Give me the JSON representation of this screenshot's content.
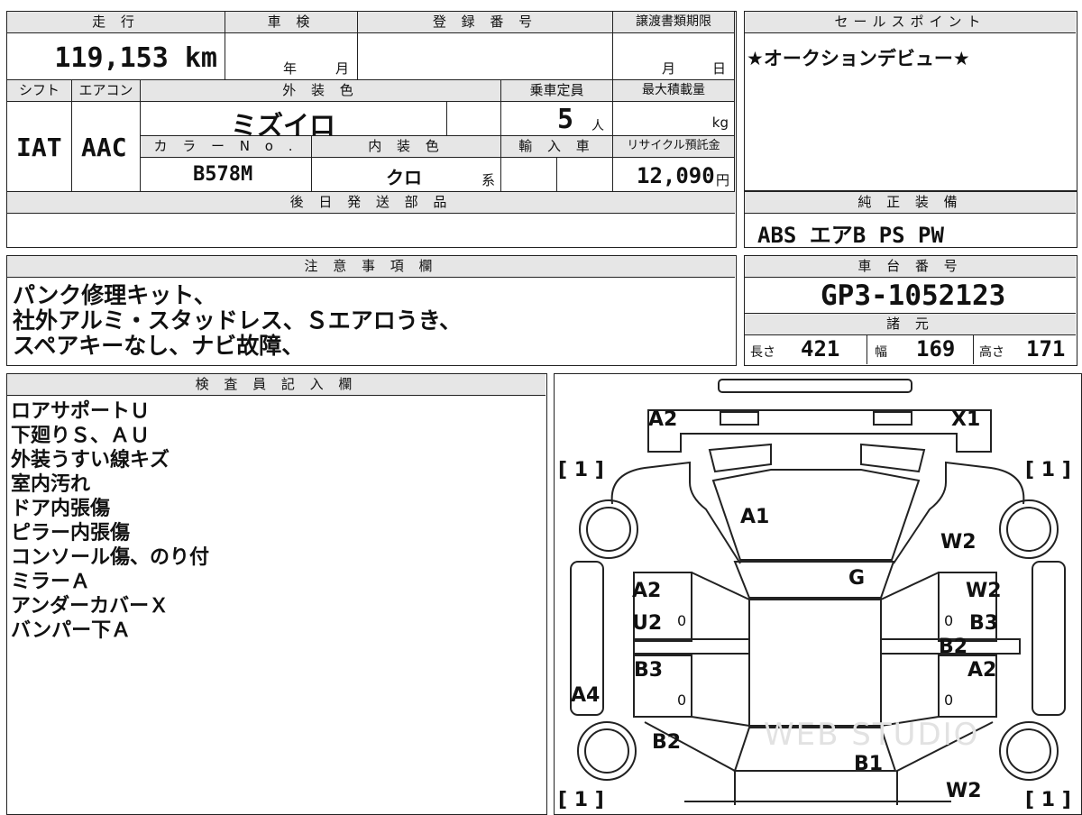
{
  "vehicle": {
    "mileage_label": "走 行",
    "mileage": "119,153 km",
    "shaken_label": "車 検",
    "shaken_year": "年",
    "shaken_month": "月",
    "reg_label": "登 録 番 号",
    "transfer_label": "譲渡書類期限",
    "transfer_month": "月",
    "transfer_day": "日",
    "shift_label": "シフト",
    "shift": "IAT",
    "ac_label": "エアコン",
    "ac": "AAC",
    "ext_color_label": "外 装 色",
    "ext_color": "ミズイロ",
    "capacity_label": "乗車定員",
    "capacity": "5",
    "capacity_unit": "人",
    "maxload_label": "最大積載量",
    "maxload_unit": "kg",
    "color_no_label": "カ ラ ー N o .",
    "color_no": "B578M",
    "int_color_label": "内 装 色",
    "int_color": "クロ",
    "int_color_suffix": "系",
    "import_label": "輸 入 車",
    "recycle_label": "リサイクル預託金",
    "recycle": "12,090",
    "recycle_unit": "円",
    "later_parts_label": "後 日 発 送 部 品"
  },
  "sales": {
    "label": "セールスポイント",
    "text": "★オークションデビュー★"
  },
  "equipment": {
    "label": "純 正 装 備",
    "text": "ABS エアB PS PW"
  },
  "notes": {
    "label": "注 意 事 項 欄",
    "lines": [
      "パンク修理キット、",
      "社外アルミ・スタッドレス、Ｓエアロうき、",
      "スペアキーなし、ナビ故障、"
    ]
  },
  "chassis": {
    "label": "車 台 番 号",
    "number": "GP3-1052123",
    "spec_label": "諸 元",
    "length_label": "長さ",
    "length": "421",
    "width_label": "幅",
    "width": "169",
    "height_label": "高さ",
    "height": "171"
  },
  "inspector": {
    "label": "検 査 員 記 入 欄",
    "lines": [
      "ロアサポートＵ",
      "下廻りＳ、ＡＵ",
      "外装うすい線キズ",
      "室内汚れ",
      "ドア内張傷",
      "ピラー内張傷",
      "コンソール傷、のり付",
      "ミラーＡ",
      "アンダーカバーＸ",
      "バンパー下Ａ"
    ]
  },
  "diagram": {
    "marks": {
      "front_left": "A2",
      "front_right": "X1",
      "bonnet": "A1",
      "windshield": "G",
      "fender_right": "W2",
      "front_door_right_top": "W2",
      "front_door_right_b": "B3",
      "center_right": "B2",
      "rear_door_right": "A2",
      "front_door_left_top": "A2",
      "front_door_left": "U2",
      "rear_door_left": "B3",
      "side_left": "A4",
      "rear_fender_left": "B2",
      "rear": "B1",
      "rear_right": "W2"
    },
    "tire": "1",
    "zero": "0",
    "watermark": "WEB STUDIO"
  }
}
